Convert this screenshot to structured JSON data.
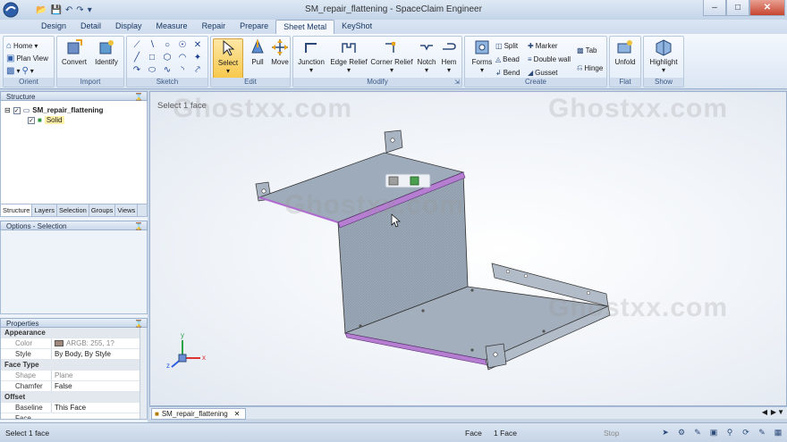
{
  "window": {
    "title": "SM_repair_flattening - SpaceClaim Engineer"
  },
  "colors": {
    "accent": "#f7c84a",
    "ribbon": "#dbe6f3",
    "part": "#9aa7b6",
    "edge_highlight": "#b06bd0"
  },
  "ribbon_tabs": [
    {
      "label": "Design"
    },
    {
      "label": "Detail"
    },
    {
      "label": "Display"
    },
    {
      "label": "Measure"
    },
    {
      "label": "Repair"
    },
    {
      "label": "Prepare"
    },
    {
      "label": "Sheet Metal"
    },
    {
      "label": "KeyShot"
    }
  ],
  "groups": {
    "orient": {
      "label": "Orient",
      "home": "Home",
      "plan_view": "Plan View"
    },
    "import": {
      "label": "Import",
      "convert": "Convert",
      "identify": "Identify"
    },
    "sketch": {
      "label": "Sketch"
    },
    "edit": {
      "label": "Edit",
      "select": "Select",
      "pull": "Pull",
      "move": "Move"
    },
    "modify": {
      "label": "Modify",
      "junction": "Junction",
      "edge_relief": "Edge Relief",
      "corner_relief": "Corner Relief",
      "notch": "Notch",
      "hem": "Hem"
    },
    "create": {
      "label": "Create",
      "forms": "Forms",
      "split": "Split",
      "bead": "Bead",
      "bend": "Bend",
      "marker": "Marker",
      "double_wall": "Double wall",
      "gusset": "Gusset",
      "tab": "Tab",
      "hinge": "Hinge"
    },
    "flat": {
      "label": "Flat",
      "unfold": "Unfold"
    },
    "show": {
      "label": "Show",
      "highlight": "Highlight"
    }
  },
  "structure": {
    "title": "Structure",
    "root": "SM_repair_flattening",
    "child": "Solid",
    "tabs": [
      "Structure",
      "Layers",
      "Selection",
      "Groups",
      "Views"
    ]
  },
  "options": {
    "title": "Options - Selection"
  },
  "properties": {
    "title": "Properties",
    "rows": [
      {
        "type": "cat",
        "k": "Appearance",
        "v": ""
      },
      {
        "type": "dim",
        "k": "Color",
        "v": "ARGB: 255, 1?"
      },
      {
        "type": "row",
        "k": "Style",
        "v": "By Body, By Style"
      },
      {
        "type": "cat",
        "k": "Face Type",
        "v": ""
      },
      {
        "type": "dim",
        "k": "Shape",
        "v": "Plane"
      },
      {
        "type": "row",
        "k": "Chamfer",
        "v": "False"
      },
      {
        "type": "cat",
        "k": "Offset",
        "v": ""
      },
      {
        "type": "row",
        "k": "Baseline Face",
        "v": "This Face"
      }
    ]
  },
  "viewport": {
    "prompt": "Select 1 face",
    "watermark": "Ghostxx.com"
  },
  "axis": {
    "x": "x",
    "y": "y",
    "z": "z"
  },
  "document_tab": {
    "label": "SM_repair_flattening"
  },
  "status_bar": {
    "message": "Select 1 face",
    "filter": "Face",
    "count": "1 Face",
    "stop": "Stop"
  }
}
